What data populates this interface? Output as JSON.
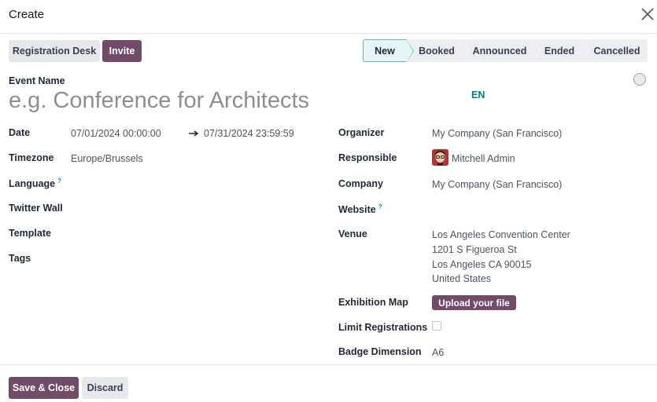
{
  "dialog": {
    "title": "Create"
  },
  "toolbar": {
    "registration_desk": "Registration Desk",
    "invite": "Invite"
  },
  "stages": [
    {
      "label": "New",
      "active": true
    },
    {
      "label": "Booked",
      "active": false
    },
    {
      "label": "Announced",
      "active": false
    },
    {
      "label": "Ended",
      "active": false
    },
    {
      "label": "Cancelled",
      "active": false
    }
  ],
  "event": {
    "name_label": "Event Name",
    "name_placeholder": "e.g. Conference for Architects",
    "lang": "EN"
  },
  "left_fields": {
    "date_label": "Date",
    "date_start": "07/01/2024 00:00:00",
    "date_end": "07/31/2024 23:59:59",
    "timezone_label": "Timezone",
    "timezone": "Europe/Brussels",
    "language_label": "Language",
    "help_mark": "?",
    "twitter_label": "Twitter Wall",
    "template_label": "Template",
    "tags_label": "Tags"
  },
  "right_fields": {
    "organizer_label": "Organizer",
    "organizer": "My Company (San Francisco)",
    "responsible_label": "Responsible",
    "responsible": "Mitchell Admin",
    "company_label": "Company",
    "company": "My Company (San Francisco)",
    "website_label": "Website",
    "venue_label": "Venue",
    "venue_lines": [
      "Los Angeles Convention Center",
      "1201 S Figueroa St",
      "Los Angeles CA 90015",
      "United States"
    ],
    "exhibition_label": "Exhibition Map",
    "upload_label": "Upload your file",
    "limit_label": "Limit Registrations",
    "limit_checked": false,
    "badge_label": "Badge Dimension",
    "badge": "A6"
  },
  "footer": {
    "save_close": "Save & Close",
    "discard": "Discard"
  },
  "colors": {
    "primary": "#714B67",
    "accent": "#017e84",
    "active_stage_border": "#66b4bd"
  },
  "icons": {
    "close": "close-icon",
    "arrow": "arrow-right-icon",
    "priority": "priority-circle-icon"
  }
}
